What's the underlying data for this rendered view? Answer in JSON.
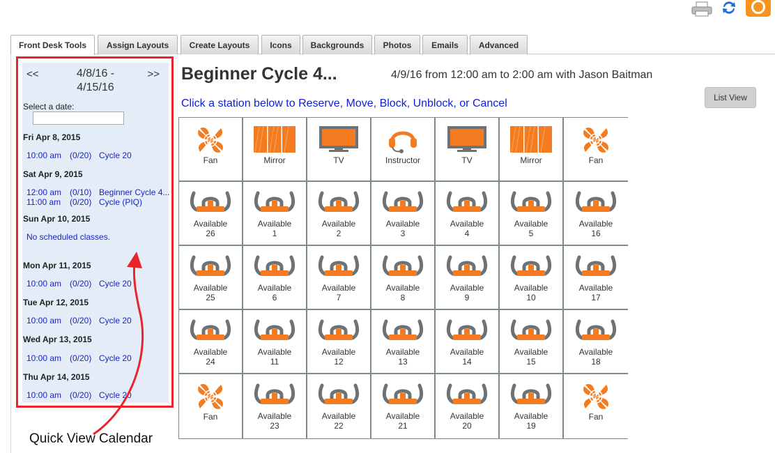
{
  "tabs": [
    "Front Desk Tools",
    "Assign Layouts",
    "Create Layouts",
    "Icons",
    "Backgrounds",
    "Photos",
    "Emails",
    "Advanced"
  ],
  "calendar": {
    "prev": "<<",
    "next": ">>",
    "range_line1": "4/8/16 -",
    "range_line2": "4/15/16",
    "select_label": "Select a date:",
    "date_value": "",
    "days": [
      {
        "date": "Fri Apr 8, 2015",
        "classes": [
          {
            "time": "10:00 am",
            "count": "(0/20)",
            "name": "Cycle 20"
          }
        ]
      },
      {
        "date": "Sat Apr 9, 2015",
        "classes": [
          {
            "time": "12:00 am",
            "count": "(0/10)",
            "name": "Beginner Cycle 4..."
          },
          {
            "time": "11:00 am",
            "count": "(0/20)",
            "name": "Cycle (PIQ)"
          }
        ]
      },
      {
        "date": "Sun Apr 10, 2015",
        "no_classes": "No scheduled classes."
      },
      {
        "date": "Mon Apr 11, 2015",
        "classes": [
          {
            "time": "10:00 am",
            "count": "(0/20)",
            "name": "Cycle 20"
          }
        ]
      },
      {
        "date": "Tue Apr 12, 2015",
        "classes": [
          {
            "time": "10:00 am",
            "count": "(0/20)",
            "name": "Cycle 20"
          }
        ]
      },
      {
        "date": "Wed Apr 13, 2015",
        "classes": [
          {
            "time": "10:00 am",
            "count": "(0/20)",
            "name": "Cycle 20"
          }
        ]
      },
      {
        "date": "Thu Apr 14, 2015",
        "classes": [
          {
            "time": "10:00 am",
            "count": "(0/20)",
            "name": "Cycle 20"
          }
        ]
      }
    ]
  },
  "annotation": "Quick View Calendar",
  "header": {
    "title": "Beginner Cycle 4...",
    "info": "4/9/16 from 12:00 am to 2:00 am with Jason Baitman",
    "instructions": "Click a station below to Reserve, Move, Block, Unblock, or Cancel",
    "list_view": "List View"
  },
  "colors": {
    "accent": "#f47b20",
    "bike_gray": "#6d7277",
    "link": "#1020d8",
    "highlight": "#e8262a"
  },
  "grid": [
    [
      {
        "type": "fan",
        "label": "Fan"
      },
      {
        "type": "mirror",
        "label": "Mirror"
      },
      {
        "type": "tv",
        "label": "TV"
      },
      {
        "type": "instructor",
        "label": "Instructor"
      },
      {
        "type": "tv",
        "label": "TV"
      },
      {
        "type": "mirror",
        "label": "Mirror"
      },
      {
        "type": "fan",
        "label": "Fan"
      }
    ],
    [
      {
        "type": "bike",
        "label": "Available",
        "num": "26"
      },
      {
        "type": "bike",
        "label": "Available",
        "num": "1"
      },
      {
        "type": "bike",
        "label": "Available",
        "num": "2"
      },
      {
        "type": "bike",
        "label": "Available",
        "num": "3"
      },
      {
        "type": "bike",
        "label": "Available",
        "num": "4"
      },
      {
        "type": "bike",
        "label": "Available",
        "num": "5"
      },
      {
        "type": "bike",
        "label": "Available",
        "num": "16"
      }
    ],
    [
      {
        "type": "bike",
        "label": "Available",
        "num": "25"
      },
      {
        "type": "bike",
        "label": "Available",
        "num": "6"
      },
      {
        "type": "bike",
        "label": "Available",
        "num": "7"
      },
      {
        "type": "bike",
        "label": "Available",
        "num": "8"
      },
      {
        "type": "bike",
        "label": "Available",
        "num": "9"
      },
      {
        "type": "bike",
        "label": "Available",
        "num": "10"
      },
      {
        "type": "bike",
        "label": "Available",
        "num": "17"
      }
    ],
    [
      {
        "type": "bike",
        "label": "Available",
        "num": "24"
      },
      {
        "type": "bike",
        "label": "Available",
        "num": "11"
      },
      {
        "type": "bike",
        "label": "Available",
        "num": "12"
      },
      {
        "type": "bike",
        "label": "Available",
        "num": "13"
      },
      {
        "type": "bike",
        "label": "Available",
        "num": "14"
      },
      {
        "type": "bike",
        "label": "Available",
        "num": "15"
      },
      {
        "type": "bike",
        "label": "Available",
        "num": "18"
      }
    ],
    [
      {
        "type": "fan",
        "label": "Fan"
      },
      {
        "type": "bike",
        "label": "Available",
        "num": "23"
      },
      {
        "type": "bike",
        "label": "Available",
        "num": "22"
      },
      {
        "type": "bike",
        "label": "Available",
        "num": "21"
      },
      {
        "type": "bike",
        "label": "Available",
        "num": "20"
      },
      {
        "type": "bike",
        "label": "Available",
        "num": "19"
      },
      {
        "type": "fan",
        "label": "Fan"
      }
    ]
  ]
}
